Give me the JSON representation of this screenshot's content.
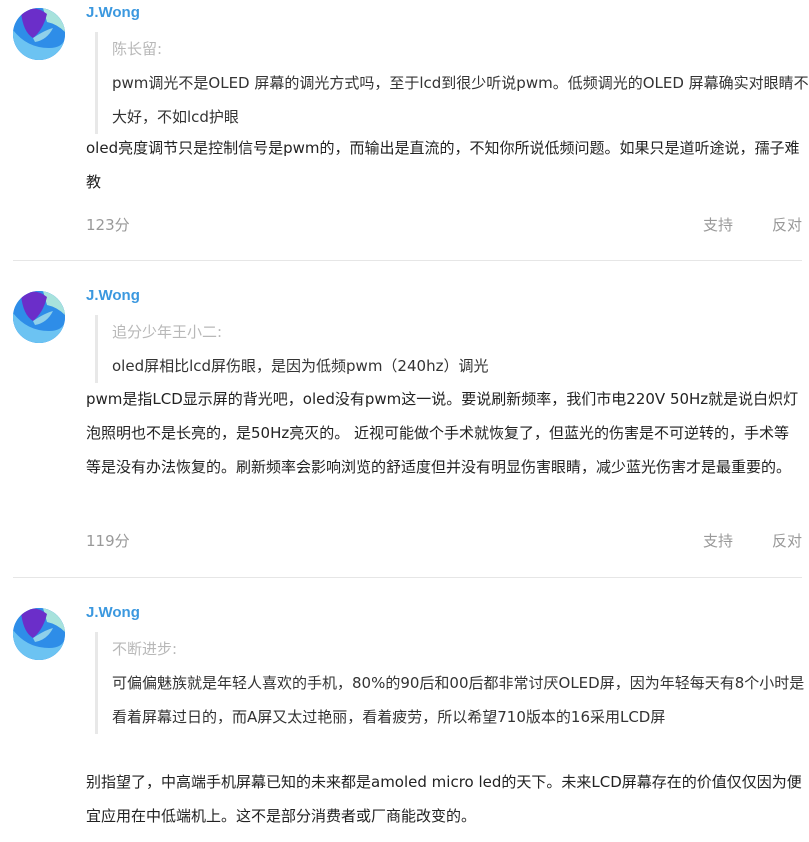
{
  "comments": [
    {
      "author": "J.Wong",
      "quote_name": "陈长留:",
      "quote_text": "pwm调光不是OLED 屏幕的调光方式吗，至于lcd到很少听说pwm。低频调光的OLED 屏幕确实对眼睛不大好，不如lcd护眼",
      "reply": "oled亮度调节只是控制信号是pwm的，而输出是直流的，不知你所说低频问题。如果只是道听途说，孺子难教",
      "score": "123分",
      "support": "支持",
      "oppose": "反对"
    },
    {
      "author": "J.Wong",
      "quote_name": "追分少年王小二:",
      "quote_text": "oled屏相比lcd屏伤眼，是因为低频pwm（240hz）调光",
      "reply": "pwm是指LCD显示屏的背光吧，oled没有pwm这一说。要说刷新频率，我们市电220V 50Hz就是说白炽灯泡照明也不是长亮的，是50Hz亮灭的。 近视可能做个手术就恢复了，但蓝光的伤害是不可逆转的，手术等等是没有办法恢复的。刷新频率会影响浏览的舒适度但并没有明显伤害眼睛，减少蓝光伤害才是最重要的。",
      "score": "119分",
      "support": "支持",
      "oppose": "反对"
    },
    {
      "author": "J.Wong",
      "quote_name": "不断进步:",
      "quote_text": "可偏偏魅族就是年轻人喜欢的手机，80%的90后和00后都非常讨厌OLED屏，因为年轻每天有8个小时是看着屏幕过日的，而A屏又太过艳丽，看着疲劳，所以希望710版本的16采用LCD屏",
      "reply": "别指望了，中高端手机屏幕已知的未来都是amoled micro led的天下。未来LCD屏幕存在的价值仅仅因为便宜应用在中低端机上。这不是部分消费者或厂商能改变的。"
    }
  ]
}
